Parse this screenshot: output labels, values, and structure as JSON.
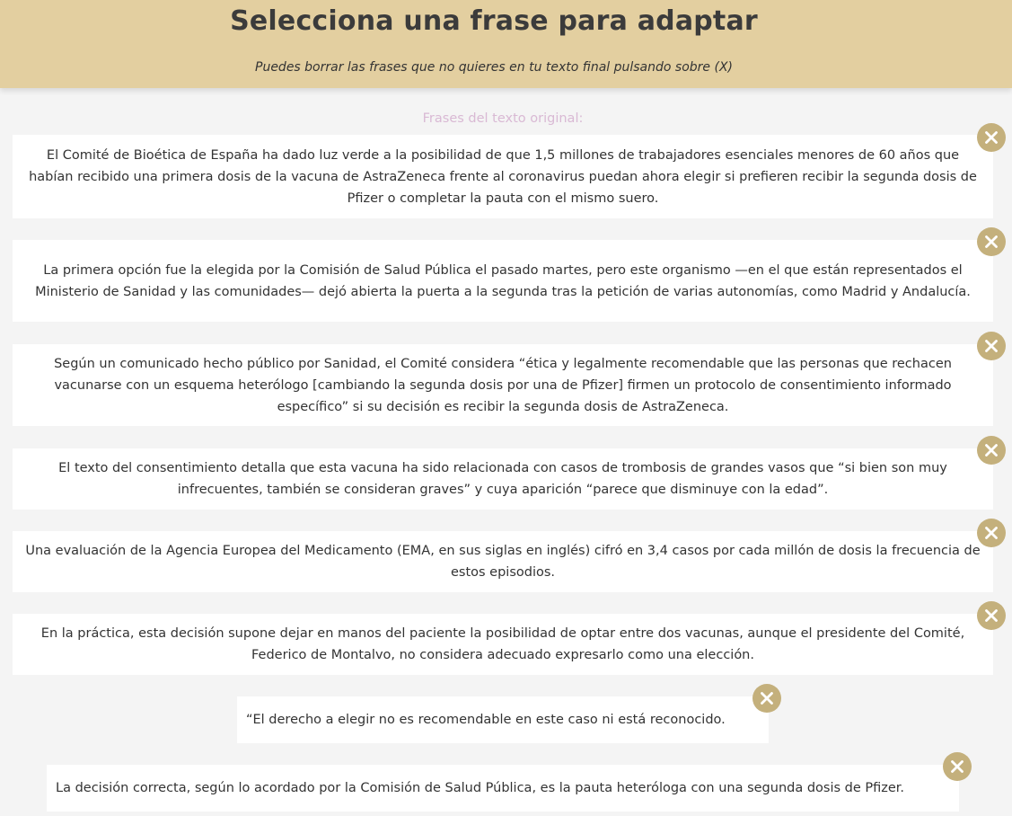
{
  "header": {
    "title": "Selecciona una frase para adaptar",
    "subtitle": "Puedes borrar las frases que no quieres en tu texto final pulsando sobre (X)"
  },
  "section_label": "Frases del texto original:",
  "sentences": [
    {
      "text": "El Comité de Bioética de España ha dado luz verde a la posibilidad de que 1,5 millones de trabajadores esenciales menores de 60 años que habían recibido una primera dosis de la vacuna de AstraZeneca frente al coronavirus puedan ahora elegir si prefieren recibir la segunda dosis de Pfizer o completar la pauta con el mismo suero.",
      "delete_icon": "close-icon"
    },
    {
      "text": "La primera opción fue la elegida por la Comisión de Salud Pública el pasado martes, pero este organismo —en el que están representados el Ministerio de Sanidad y las comunidades— dejó abierta la puerta a la segunda tras la petición de varias autonomías, como Madrid y Andalucía.",
      "delete_icon": "close-icon"
    },
    {
      "text": "Según un comunicado hecho público por Sanidad, el Comité considera “ética y legalmente recomendable que las personas que rechacen vacunarse con un esquema heterólogo [cambiando la segunda dosis por una de Pfizer] firmen un protocolo de consentimiento informado específico” si su decisión es recibir la segunda dosis de AstraZeneca.",
      "delete_icon": "close-icon"
    },
    {
      "text": "El texto del consentimiento detalla que esta vacuna ha sido relacionada con casos de trombosis de grandes vasos que “si bien son muy infrecuentes, también se consideran graves” y cuya aparición “parece que disminuye con la edad”.",
      "delete_icon": "close-icon"
    },
    {
      "text": "Una evaluación de la Agencia Europea del Medicamento (EMA, en sus siglas en inglés) cifró en 3,4 casos por cada millón de dosis la frecuencia de estos episodios.",
      "delete_icon": "close-icon"
    },
    {
      "text": "En la práctica, esta decisión supone dejar en manos del paciente la posibilidad de optar entre dos vacunas, aunque el presidente del Comité, Federico de Montalvo, no considera adecuado expresarlo como una elección.",
      "delete_icon": "close-icon"
    },
    {
      "text": "“El derecho a elegir no es recomendable en este caso ni está reconocido.",
      "delete_icon": "close-icon"
    },
    {
      "text": "La decisión correcta, según lo acordado por la Comisión de Salud Pública, es la pauta heteróloga con una segunda dosis de Pfizer.",
      "delete_icon": "close-icon"
    }
  ],
  "colors": {
    "header_bg": "#e3cfa0",
    "page_bg": "#f4f4f4",
    "card_bg": "#ffffff",
    "delete_button": "#c4b07c",
    "section_label": "#d9b9d4"
  }
}
